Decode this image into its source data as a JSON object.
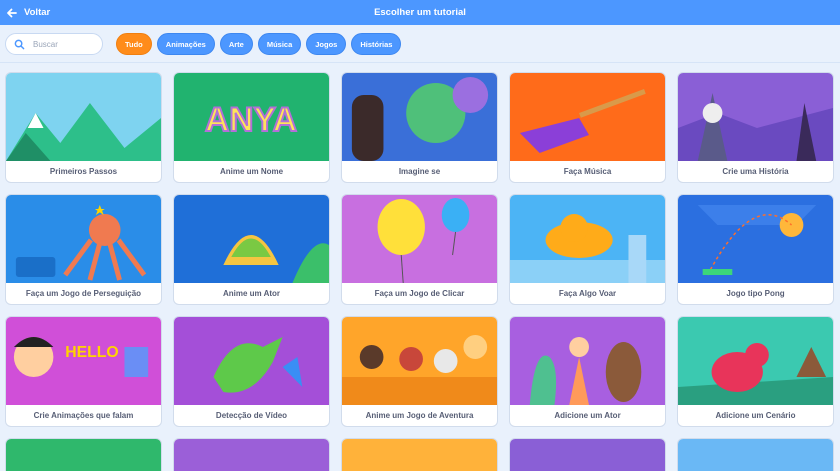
{
  "header": {
    "back_label": "Voltar",
    "title": "Escolher um tutorial"
  },
  "search": {
    "placeholder": "Buscar"
  },
  "filters": [
    {
      "label": "Tudo",
      "active": true
    },
    {
      "label": "Animações",
      "active": false
    },
    {
      "label": "Arte",
      "active": false
    },
    {
      "label": "Música",
      "active": false
    },
    {
      "label": "Jogos",
      "active": false
    },
    {
      "label": "Histórias",
      "active": false
    }
  ],
  "tutorials": [
    {
      "label": "Primeiros Passos",
      "bg": "#7ed3f0",
      "art": "mountains"
    },
    {
      "label": "Anime um Nome",
      "bg": "#21b36f",
      "art": "letters"
    },
    {
      "label": "Imagine se",
      "bg": "#3a6fd8",
      "art": "globe"
    },
    {
      "label": "Faça Música",
      "bg": "#ff6b1a",
      "art": "guitar"
    },
    {
      "label": "Crie uma História",
      "bg": "#8a5fd6",
      "art": "wizard"
    },
    {
      "label": "Faça um Jogo de Perseguição",
      "bg": "#2a8de8",
      "art": "octopus"
    },
    {
      "label": "Anime um Ator",
      "bg": "#1f6fd8",
      "art": "taco"
    },
    {
      "label": "Faça um Jogo de Clicar",
      "bg": "#c86fe0",
      "art": "balloon"
    },
    {
      "label": "Faça Algo Voar",
      "bg": "#4cb4f5",
      "art": "cat"
    },
    {
      "label": "Jogo tipo Pong",
      "bg": "#2b6fe0",
      "art": "pong"
    },
    {
      "label": "Crie Animações que falam",
      "bg": "#d04fd8",
      "art": "hello"
    },
    {
      "label": "Detecção de Vídeo",
      "bg": "#a44fd8",
      "art": "dragon"
    },
    {
      "label": "Anime um Jogo de Aventura",
      "bg": "#ffa52a",
      "art": "crew"
    },
    {
      "label": "Adicione um Ator",
      "bg": "#a85fe0",
      "art": "fairy"
    },
    {
      "label": "Adicione um Cenário",
      "bg": "#3bc9b0",
      "art": "dino"
    }
  ],
  "partial_row": [
    {
      "bg": "#2fb86c"
    },
    {
      "bg": "#9b5fd8"
    },
    {
      "bg": "#ffb23a"
    },
    {
      "bg": "#8a5fd6"
    },
    {
      "bg": "#6ab8f5"
    }
  ]
}
